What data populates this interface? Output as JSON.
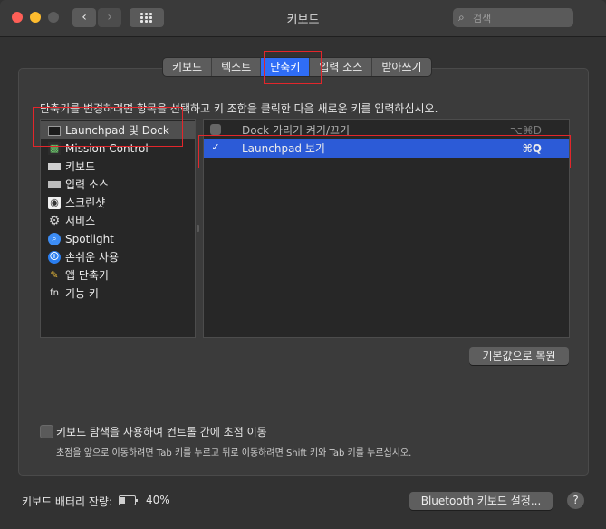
{
  "window": {
    "title": "키보드"
  },
  "titlebar": {
    "back_glyph": "‹",
    "forward_glyph": "›"
  },
  "search": {
    "placeholder": "검색",
    "value": ""
  },
  "tabs": [
    {
      "label": "키보드",
      "active": false
    },
    {
      "label": "텍스트",
      "active": false
    },
    {
      "label": "단축키",
      "active": true
    },
    {
      "label": "입력 소스",
      "active": false
    },
    {
      "label": "받아쓰기",
      "active": false
    }
  ],
  "instruction": "단축키를 변경하려면 항목을 선택하고 키 조합을 클릭한 다음 새로운 키를 입력하십시오.",
  "categories": [
    {
      "label": "Launchpad 및 Dock",
      "icon": "launchpad-icon",
      "selected": true
    },
    {
      "label": "Mission Control",
      "icon": "mission-control-icon",
      "selected": false
    },
    {
      "label": "키보드",
      "icon": "keyboard-icon",
      "selected": false
    },
    {
      "label": "입력 소스",
      "icon": "input-source-icon",
      "selected": false
    },
    {
      "label": "스크린샷",
      "icon": "screenshot-icon",
      "selected": false
    },
    {
      "label": "서비스",
      "icon": "services-gear-icon",
      "selected": false
    },
    {
      "label": "Spotlight",
      "icon": "spotlight-icon",
      "selected": false
    },
    {
      "label": "손쉬운 사용",
      "icon": "accessibility-icon",
      "selected": false
    },
    {
      "label": "앱 단축키",
      "icon": "app-shortcuts-icon",
      "selected": false
    },
    {
      "label": "기능 키",
      "icon": "function-key-icon",
      "selected": false
    }
  ],
  "shortcuts": [
    {
      "label": "Dock 가리기 켜기/끄기",
      "key": "⌥⌘D",
      "checked": false
    },
    {
      "label": "Launchpad 보기",
      "key": "⌘Q",
      "checked": true
    }
  ],
  "restore_button": "기본값으로 복원",
  "keyboard_nav": {
    "label": "키보드 탐색을 사용하여 컨트롤 간에 초점 이동",
    "checked": false,
    "hint": "초점을 앞으로 이동하려면 Tab 키를 누르고 뒤로 이동하려면 Shift 키와 Tab 키를 누르십시오."
  },
  "battery": {
    "label": "키보드 배터리 잔량:",
    "percent": "40%"
  },
  "bluetooth_button": "Bluetooth 키보드 설정...",
  "help_label": "?",
  "colors": {
    "accent": "#2f6df6",
    "selection": "#2c5bd7",
    "annotation": "#e3262b"
  }
}
